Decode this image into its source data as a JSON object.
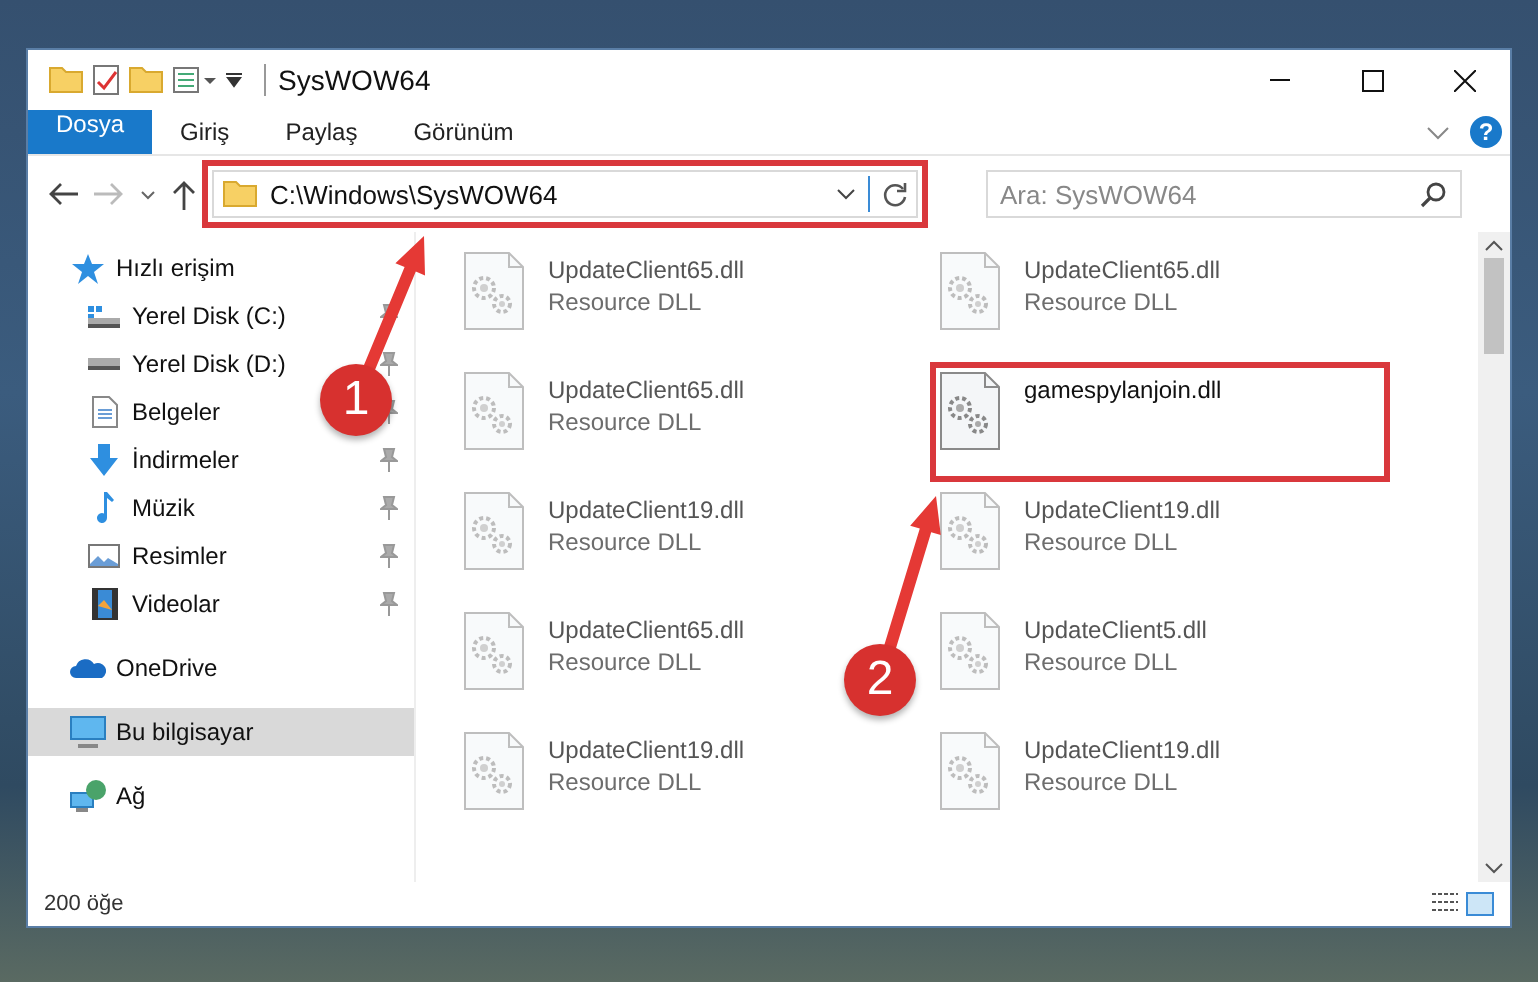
{
  "window": {
    "title": "SysWOW64"
  },
  "ribbon_tabs": [
    {
      "label": "Dosya",
      "kind": "file"
    },
    {
      "label": "Giriş",
      "kind": "tab"
    },
    {
      "label": "Paylaş",
      "kind": "tab"
    },
    {
      "label": "Görünüm",
      "kind": "tab"
    }
  ],
  "help_button": "?",
  "address_bar": {
    "path": "C:\\Windows\\SysWOW64",
    "highlighted": true
  },
  "search": {
    "placeholder": "Ara: SysWOW64"
  },
  "sidebar": {
    "items": [
      {
        "label": "Hızlı erişim",
        "selected": false,
        "children": [
          {
            "label": "Yerel Disk (C:)",
            "pinned": true,
            "selected": false
          },
          {
            "label": "Yerel Disk (D:)",
            "pinned": true,
            "selected": false
          },
          {
            "label": "Belgeler",
            "pinned": true,
            "selected": false
          },
          {
            "label": "İndirmeler",
            "pinned": true,
            "selected": false
          },
          {
            "label": "Müzik",
            "pinned": true,
            "selected": false
          },
          {
            "label": "Resimler",
            "pinned": true,
            "selected": false
          },
          {
            "label": "Videolar",
            "pinned": true,
            "selected": false
          }
        ]
      },
      {
        "label": "OneDrive",
        "selected": false
      },
      {
        "label": "Bu bilgisayar",
        "selected": true
      },
      {
        "label": "Ağ",
        "selected": false
      }
    ]
  },
  "files": [
    {
      "name": "UpdateClient65.dll",
      "type": "Resource DLL",
      "highlighted": false
    },
    {
      "name": "UpdateClient65.dll",
      "type": "Resource DLL",
      "highlighted": false
    },
    {
      "name": "UpdateClient65.dll",
      "type": "Resource DLL",
      "highlighted": false
    },
    {
      "name": "gamespylanjoin.dll",
      "highlighted": true
    },
    {
      "name": "UpdateClient19.dll",
      "type": "Resource DLL",
      "highlighted": false
    },
    {
      "name": "UpdateClient19.dll",
      "type": "Resource DLL",
      "highlighted": false
    },
    {
      "name": "UpdateClient65.dll",
      "type": "Resource DLL",
      "highlighted": false
    },
    {
      "name": "UpdateClient5.dll",
      "type": "Resource DLL",
      "highlighted": false
    },
    {
      "name": "UpdateClient19.dll",
      "type": "Resource DLL",
      "highlighted": false
    },
    {
      "name": "UpdateClient19.dll",
      "type": "Resource DLL",
      "highlighted": false
    }
  ],
  "status_bar": {
    "count": "200 öğe"
  },
  "callouts": [
    {
      "label": "1"
    },
    {
      "label": "2"
    }
  ]
}
